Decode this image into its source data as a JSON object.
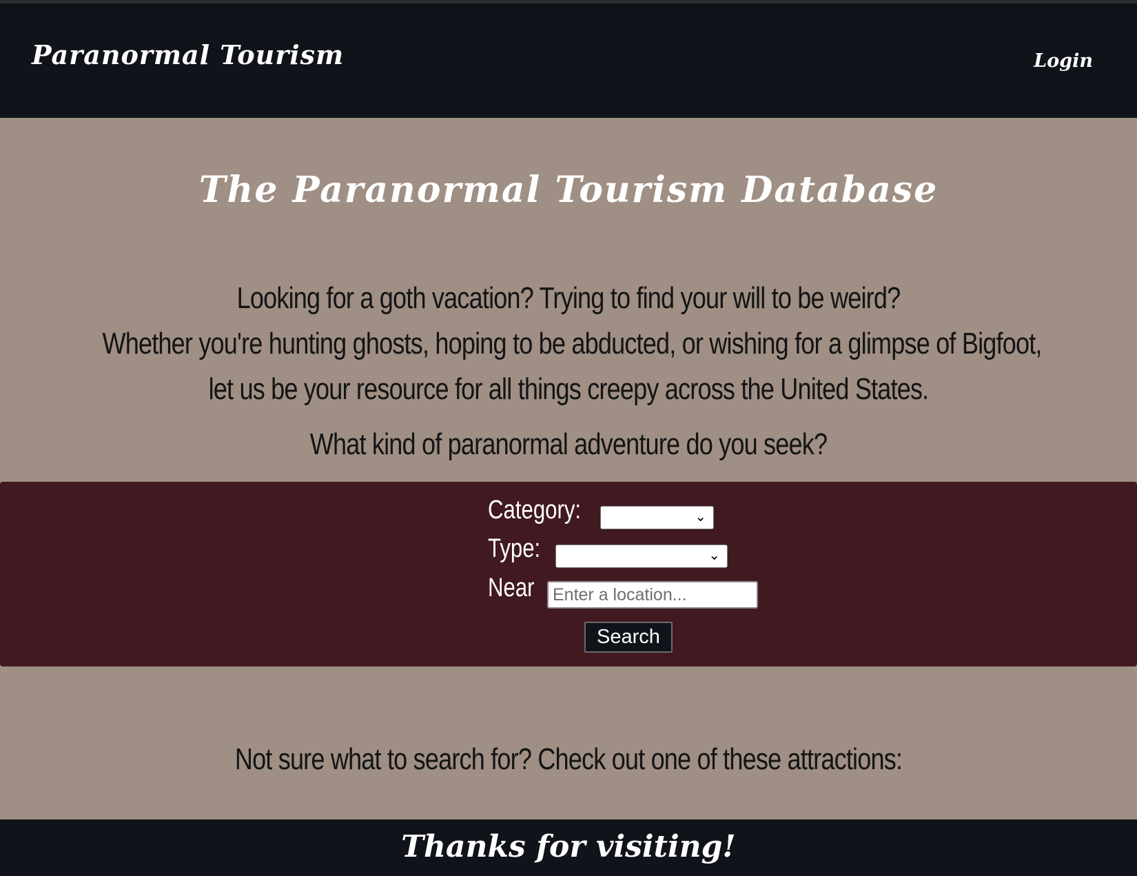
{
  "nav": {
    "brand": "Paranormal Tourism",
    "login": "Login"
  },
  "hero": {
    "title": "The Paranormal Tourism Database",
    "intro_lines": [
      "Looking for a goth vacation? Trying to find your will to be weird?",
      "Whether you're hunting ghosts, hoping to be abducted, or wishing for a glimpse of Bigfoot,",
      "let us be your resource for all things creepy across the United States."
    ],
    "prompt": "What kind of paranormal adventure do you seek?"
  },
  "search": {
    "category_label": "Category:",
    "category_value": "",
    "type_label": "Type:",
    "type_value": "",
    "near_label": "Near",
    "near_placeholder": "Enter a location...",
    "near_value": "",
    "button_label": "Search"
  },
  "attractions": {
    "text": "Not sure what to search for? Check out one of these attractions:"
  },
  "footer": {
    "text": "Thanks for visiting!"
  },
  "colors": {
    "page_background": "#9f8f84",
    "navbar_background": "#10131a",
    "search_panel_background": "#411921",
    "heading_text": "#ffffff",
    "body_text": "#141414"
  },
  "icons": {
    "select_arrow": "chevron-down-icon"
  }
}
